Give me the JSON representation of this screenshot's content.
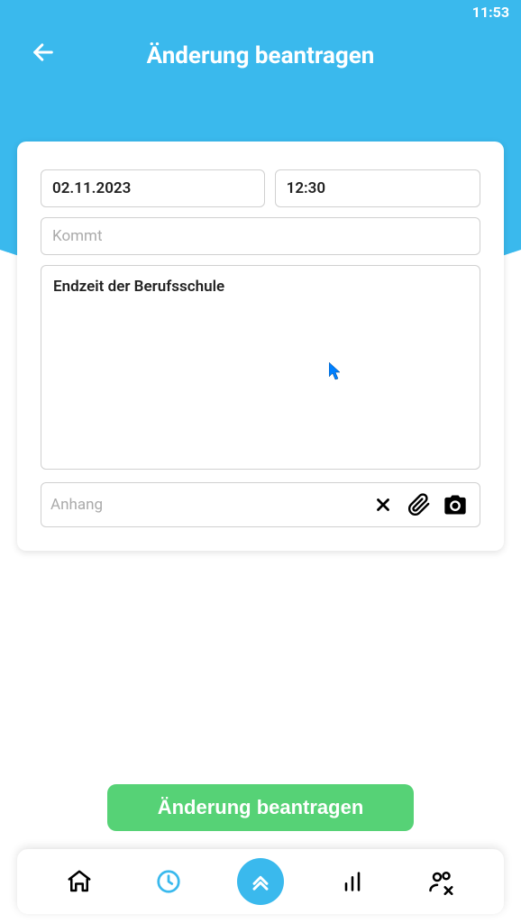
{
  "status": {
    "time": "11:53"
  },
  "header": {
    "title": "Änderung beantragen"
  },
  "form": {
    "date": "02.11.2023",
    "time": "12:30",
    "type_placeholder": "Kommt",
    "comment": "Endzeit der Berufsschule",
    "attachment_placeholder": "Anhang"
  },
  "submit": {
    "label": "Änderung beantragen"
  }
}
